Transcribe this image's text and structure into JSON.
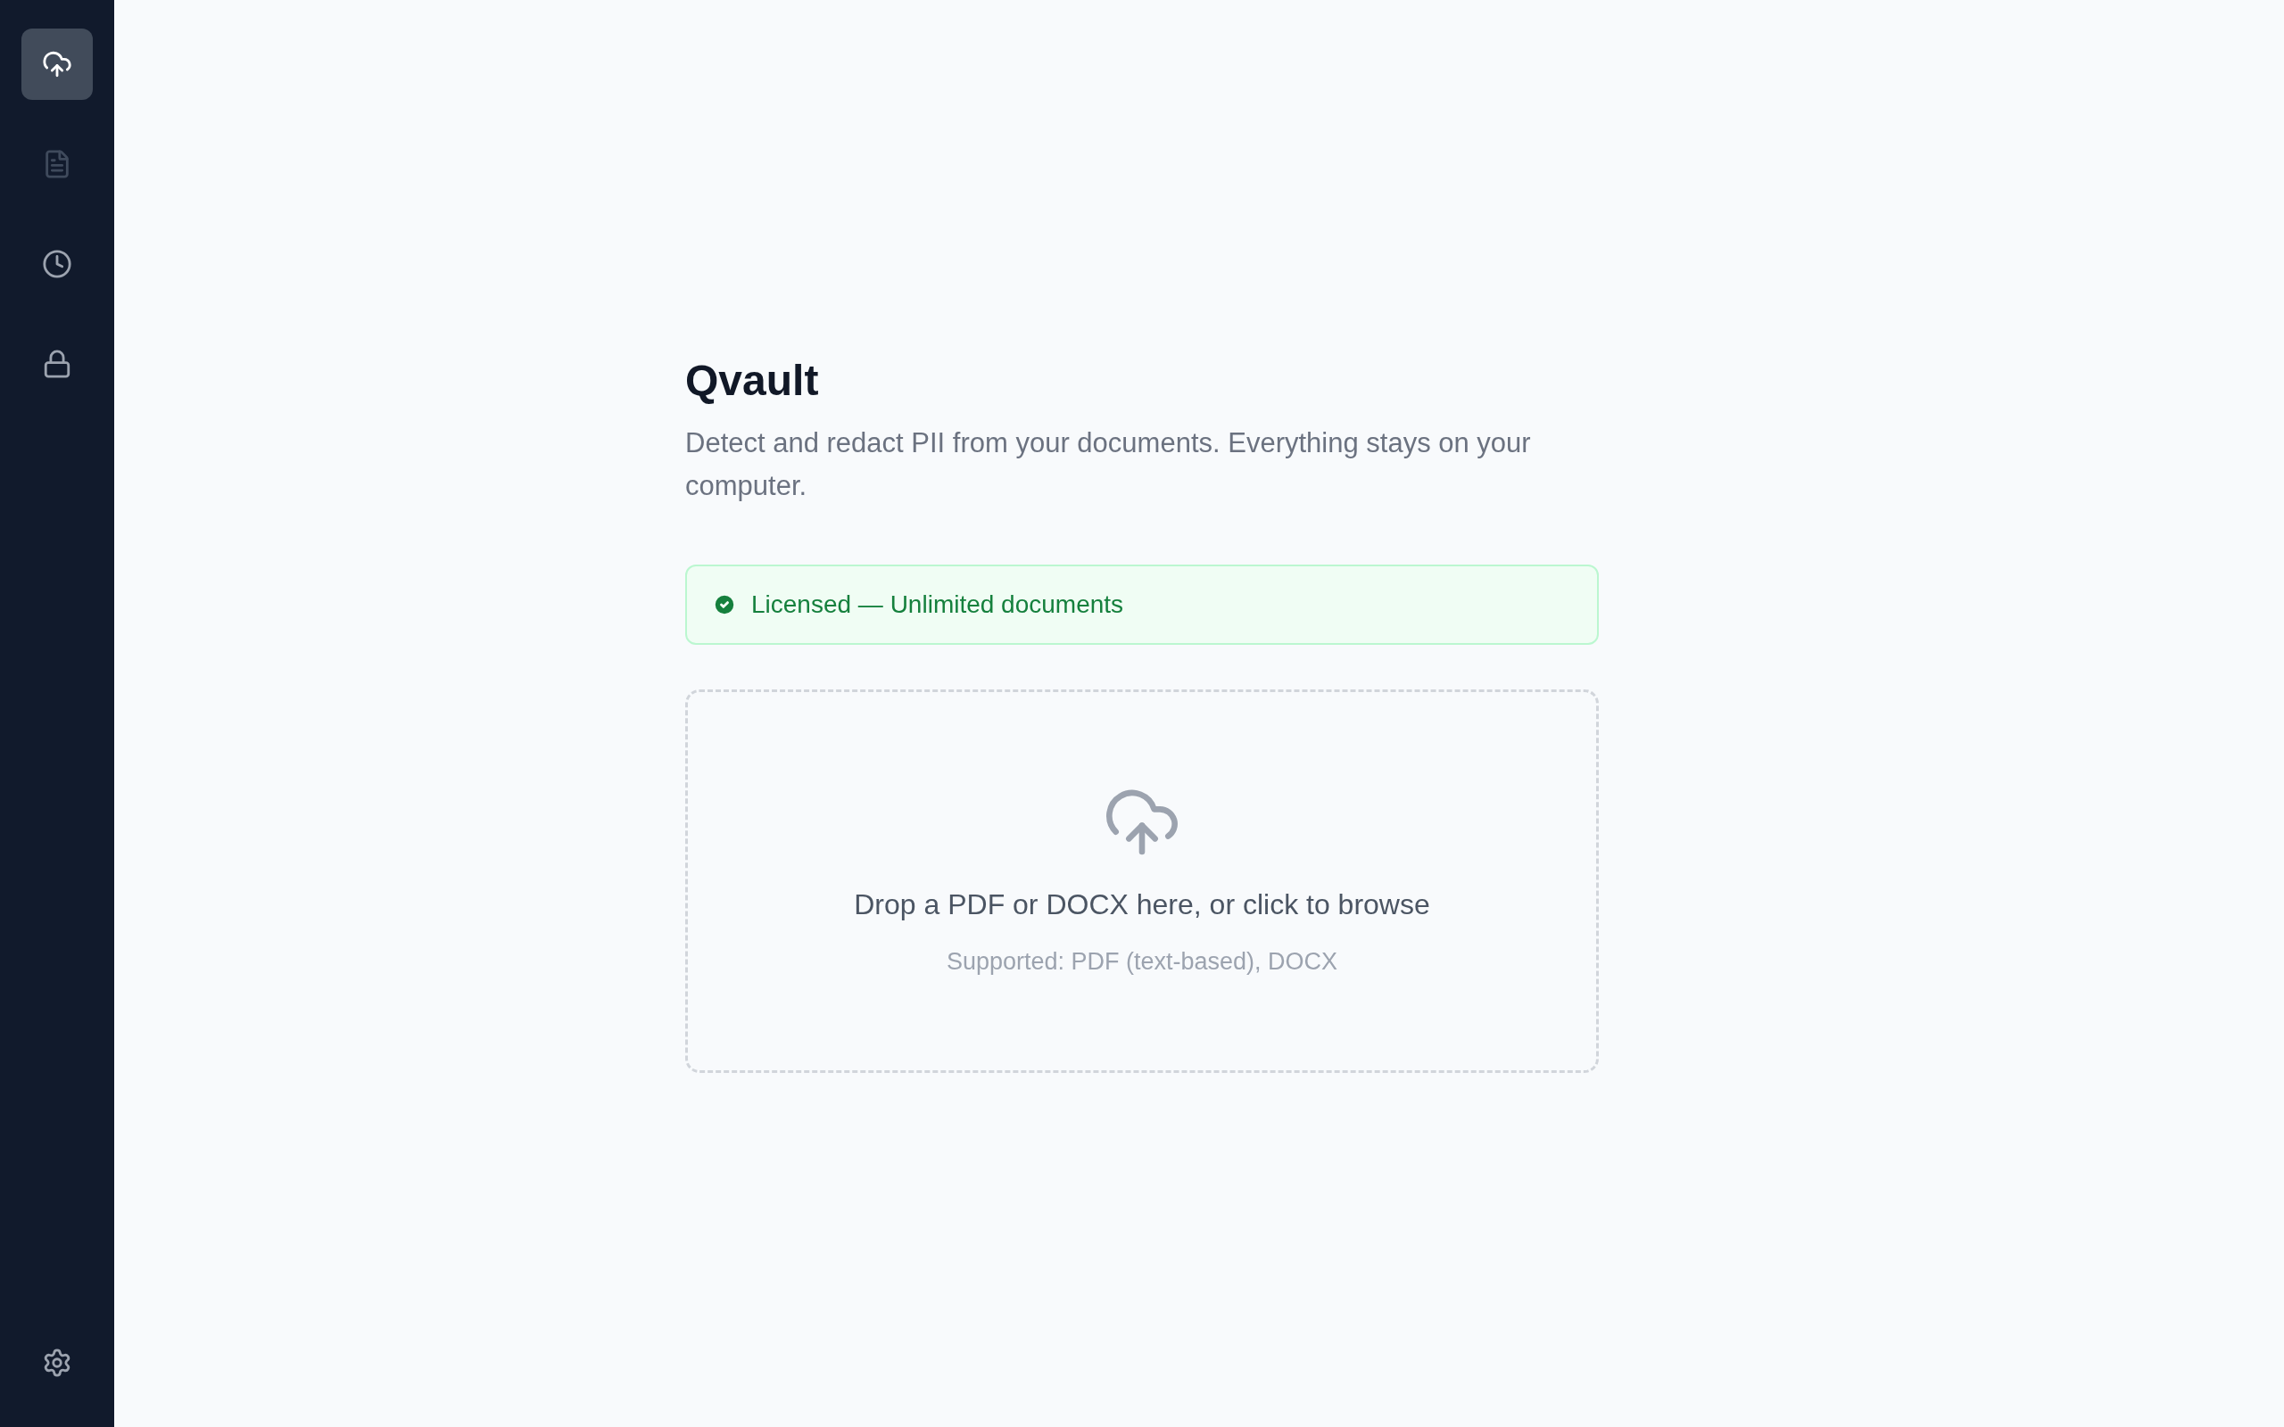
{
  "sidebar": {
    "items": [
      {
        "kind": "upload",
        "selected": true,
        "disabled": false
      },
      {
        "kind": "document",
        "selected": false,
        "disabled": true
      },
      {
        "kind": "history",
        "selected": false,
        "disabled": false
      },
      {
        "kind": "lock",
        "selected": false,
        "disabled": false
      }
    ],
    "footer_items": [
      {
        "kind": "settings",
        "selected": false,
        "disabled": false
      }
    ]
  },
  "header": {
    "title": "Qvault",
    "description": "Detect and redact PII from your documents. Everything stays on your computer."
  },
  "license_banner": {
    "text": "Licensed — Unlimited documents"
  },
  "dropzone": {
    "prompt": "Drop a PDF or DOCX here, or click to browse",
    "hint": "Supported: PDF (text-based), DOCX"
  }
}
